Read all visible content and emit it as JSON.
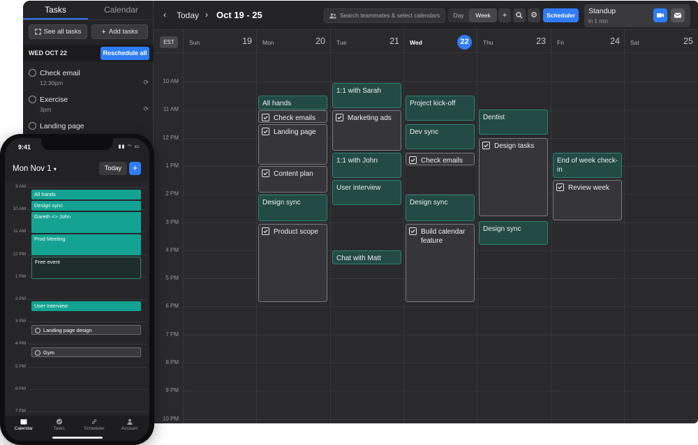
{
  "desktop": {
    "sidebar": {
      "tabs": [
        "Tasks",
        "Calendar"
      ],
      "see_all_label": "See all tasks",
      "add_tasks_label": "Add tasks",
      "date_label": "WED OCT 22",
      "reschedule_label": "Reschedule all",
      "tasks": [
        {
          "title": "Check email",
          "time": "12:30pm",
          "repeat_icon": "repeat-icon"
        },
        {
          "title": "Exercise",
          "time": "3pm",
          "repeat_icon": "repeat-icon"
        },
        {
          "title": "Landing page",
          "time": "",
          "repeat_icon": ""
        }
      ]
    },
    "toolbar": {
      "today_label": "Today",
      "range_label": "Oct 19 - 25",
      "search_placeholder": "Search teammates & select calendars",
      "view_day": "Day",
      "view_week": "Week",
      "scheduler_label": "Scheduler"
    },
    "standup": {
      "title": "Standup",
      "subtitle": "in 1 min"
    },
    "timezone": "EST",
    "days": [
      {
        "name": "Sun",
        "date": "19"
      },
      {
        "name": "Mon",
        "date": "20"
      },
      {
        "name": "Tue",
        "date": "21"
      },
      {
        "name": "Wed",
        "date": "22"
      },
      {
        "name": "Thu",
        "date": "23"
      },
      {
        "name": "Fri",
        "date": "24"
      },
      {
        "name": "Sat",
        "date": "25"
      }
    ],
    "today_index": 3,
    "hours": [
      "10 AM",
      "11 AM",
      "12 PM",
      "1 PM",
      "2 PM",
      "3 PM",
      "4 PM",
      "5 PM",
      "6 PM",
      "7 PM",
      "8 PM",
      "9 PM",
      "10 PM"
    ],
    "events": [
      {
        "day": 1,
        "title": "All hands",
        "kind": "teal",
        "task": false
      },
      {
        "day": 1,
        "title": "Check emails",
        "kind": "grey",
        "task": true
      },
      {
        "day": 1,
        "title": "Landing page",
        "kind": "grey",
        "task": true
      },
      {
        "day": 1,
        "title": "Content plan",
        "kind": "grey",
        "task": true
      },
      {
        "day": 1,
        "title": "Design sync",
        "kind": "teal",
        "task": false
      },
      {
        "day": 1,
        "title": "Product scope",
        "kind": "grey",
        "task": true
      },
      {
        "day": 2,
        "title": "1:1 with Sarah",
        "kind": "teal",
        "task": false
      },
      {
        "day": 2,
        "title": "Marketing ads",
        "kind": "grey",
        "task": true
      },
      {
        "day": 2,
        "title": "1:1 with John",
        "kind": "teal",
        "task": false
      },
      {
        "day": 2,
        "title": "User interview",
        "kind": "teal",
        "task": false
      },
      {
        "day": 2,
        "title": "Chat with Matt",
        "kind": "teal",
        "task": false
      },
      {
        "day": 3,
        "title": "Project kick-off",
        "kind": "teal",
        "task": false
      },
      {
        "day": 3,
        "title": "Dev sync",
        "kind": "teal",
        "task": false
      },
      {
        "day": 3,
        "title": "Check emails",
        "kind": "grey",
        "task": true
      },
      {
        "day": 3,
        "title": "Design sync",
        "kind": "teal",
        "task": false
      },
      {
        "day": 3,
        "title": "Build calendar feature",
        "kind": "grey",
        "task": true
      },
      {
        "day": 4,
        "title": "Dentist",
        "kind": "teal",
        "task": false
      },
      {
        "day": 4,
        "title": "Design tasks",
        "kind": "grey",
        "task": true
      },
      {
        "day": 4,
        "title": "Design sync",
        "kind": "teal",
        "task": false
      },
      {
        "day": 5,
        "title": "End of week check-in",
        "kind": "teal",
        "task": false
      },
      {
        "day": 5,
        "title": "Review week",
        "kind": "grey",
        "task": true
      }
    ]
  },
  "phone": {
    "time": "9:41",
    "date_label": "Mon Nov 1",
    "today_label": "Today",
    "plus_label": "+",
    "hours": [
      "9 AM",
      "10 AM",
      "11 AM",
      "12 PM",
      "1 PM",
      "2 PM",
      "3 PM",
      "4 PM",
      "5 PM",
      "6 PM",
      "7 PM"
    ],
    "events": [
      {
        "title": "All hands",
        "kind": "teal"
      },
      {
        "title": "Design sync",
        "kind": "teal"
      },
      {
        "title": "Gareth <> John",
        "kind": "teal"
      },
      {
        "title": "Prod Meeting",
        "kind": "teal"
      },
      {
        "title": "Free event",
        "kind": "dark"
      },
      {
        "title": "User Interview",
        "kind": "teal"
      },
      {
        "title": "Landing page design",
        "kind": "grey"
      },
      {
        "title": "Gym",
        "kind": "grey"
      }
    ],
    "tabs": [
      {
        "label": "Calendar",
        "icon": "calendar-icon"
      },
      {
        "label": "Tasks",
        "icon": "check-circle-icon"
      },
      {
        "label": "Scheduler",
        "icon": "link-icon"
      },
      {
        "label": "Account",
        "icon": "person-icon"
      }
    ]
  },
  "colors": {
    "accent": "#2f7cf6",
    "teal": "#14a392",
    "background": "#2a2a2d"
  }
}
